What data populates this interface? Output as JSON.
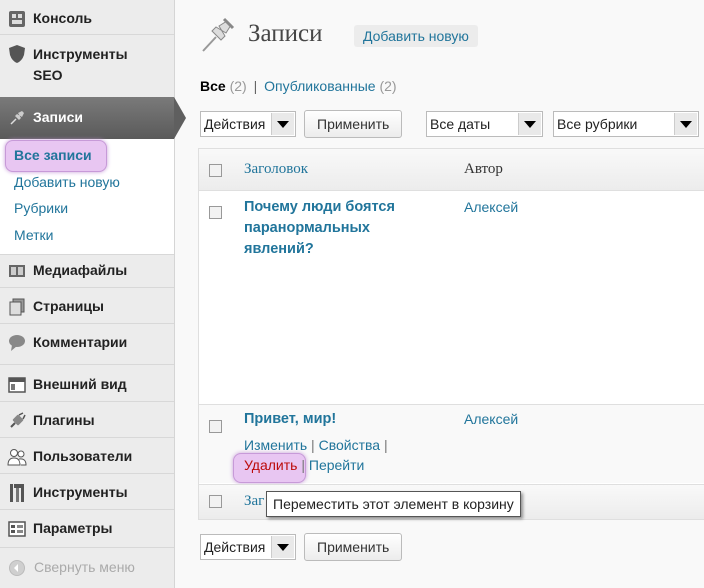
{
  "sidebar": {
    "items": [
      {
        "label": "Консоль",
        "icon": "dashboard-icon"
      },
      {
        "label": "Инструменты SEO",
        "icon": "shield-icon"
      },
      {
        "label": "Записи",
        "icon": "pushpin-icon"
      },
      {
        "label": "Медиафайлы",
        "icon": "media-icon"
      },
      {
        "label": "Страницы",
        "icon": "pages-icon"
      },
      {
        "label": "Комментарии",
        "icon": "comment-icon"
      },
      {
        "label": "Внешний вид",
        "icon": "appearance-icon"
      },
      {
        "label": "Плагины",
        "icon": "plugin-icon"
      },
      {
        "label": "Пользователи",
        "icon": "users-icon"
      },
      {
        "label": "Инструменты",
        "icon": "tools-icon"
      },
      {
        "label": "Параметры",
        "icon": "settings-icon"
      }
    ],
    "seo_line1": "Инструменты",
    "seo_line2": "SEO",
    "posts_submenu": [
      "Все записи",
      "Добавить новую",
      "Рубрики",
      "Метки"
    ],
    "collapse_label": "Свернуть меню"
  },
  "header": {
    "title": "Записи",
    "add_new_label": "Добавить новую"
  },
  "filters": {
    "all_label": "Все",
    "all_count": "(2)",
    "separator": "|",
    "published_label": "Опубликованные",
    "published_count": "(2)"
  },
  "bulk": {
    "actions_label": "Действия",
    "apply_label": "Применить",
    "dates_label": "Все даты",
    "categories_label": "Все рубрики"
  },
  "table": {
    "columns": [
      "Заголовок",
      "Автор"
    ],
    "rows": [
      {
        "title": "Почему люди боятся паранормальных явлений?",
        "title_lines": [
          "Почему люди боятся",
          "паранормальных",
          "явлений?"
        ],
        "author": "Алексей"
      },
      {
        "title": "Привет, мир!",
        "title_lines": [
          "Привет, мир!"
        ],
        "author": "Алексей",
        "actions": {
          "edit": "Изменить",
          "quick": "Свойства",
          "trash": "Удалить",
          "view": "Перейти"
        }
      }
    ],
    "footer_column": "Заголовок",
    "footer_column_partial": "Заг"
  },
  "tooltip": "Переместить этот элемент в корзину",
  "colors": {
    "link": "#21759b",
    "highlight": "#e8c6f2",
    "active_menu": "#5f5f5f"
  }
}
